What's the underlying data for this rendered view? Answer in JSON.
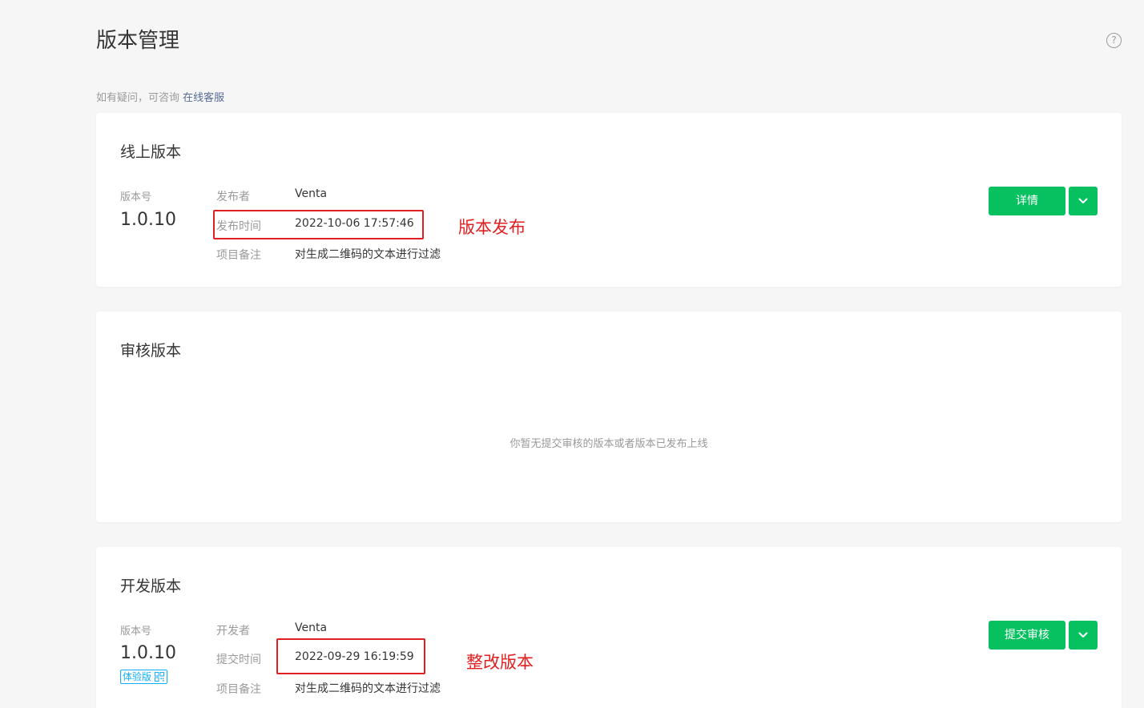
{
  "page": {
    "title": "版本管理",
    "help_icon": "?",
    "hint_prefix": "如有疑问，可咨询",
    "hint_link": "在线客服"
  },
  "online": {
    "title": "线上版本",
    "version_label": "版本号",
    "version": "1.0.10",
    "publisher_label": "发布者",
    "publisher": "Venta",
    "time_label": "发布时间",
    "time": "2022-10-06 17:57:46",
    "note_label": "项目备注",
    "note": "对生成二维码的文本进行过滤",
    "detail_button": "详情",
    "annotation": "版本发布"
  },
  "review": {
    "title": "审核版本",
    "empty": "你暂无提交审核的版本或者版本已发布上线"
  },
  "dev": {
    "title": "开发版本",
    "version_label": "版本号",
    "version": "1.0.10",
    "badge": "体验版",
    "developer_label": "开发者",
    "developer": "Venta",
    "time_label": "提交时间",
    "time": "2022-09-29 16:19:59",
    "note_label": "项目备注",
    "note": "对生成二维码的文本进行过滤",
    "submit_button": "提交审核",
    "annotation": "整改版本"
  },
  "colors": {
    "brand_green": "#07c160",
    "annotation_red": "#e02020",
    "link_blue": "#576b95",
    "badge_blue": "#10aeff"
  }
}
